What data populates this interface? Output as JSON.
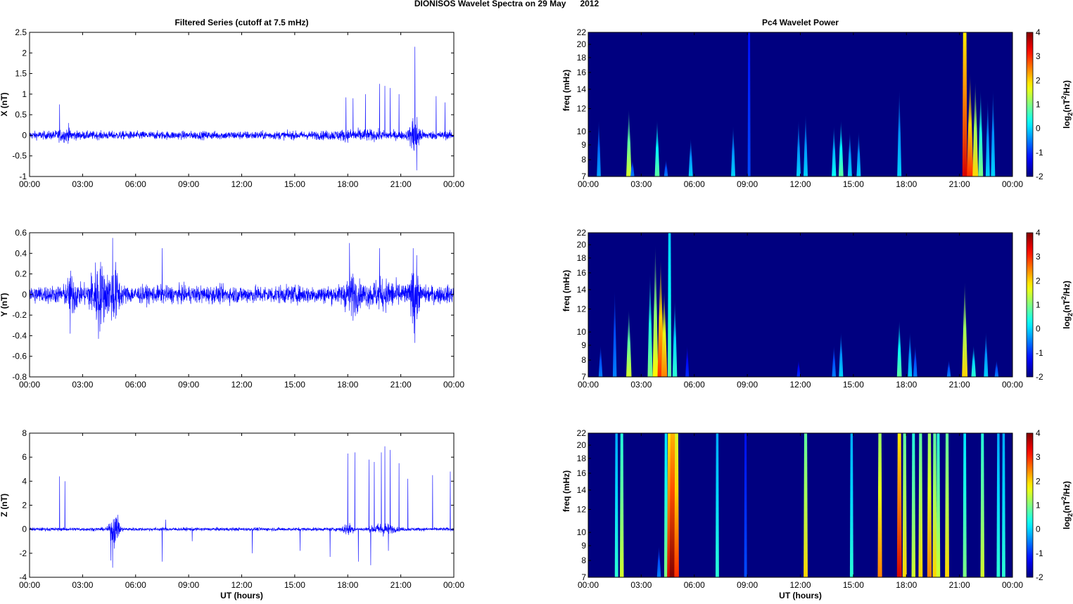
{
  "figure_title": "DIONISOS Wavelet Spectra on 29 May      2012",
  "chart_data": [
    {
      "type": "line",
      "title": "Filtered Series (cutoff at 7.5 mHz)",
      "ylabel": "X (nT)",
      "xlabel": "",
      "xlim": [
        0,
        24
      ],
      "ylim": [
        -1,
        2.5
      ],
      "xticks": [
        "00:00",
        "03:00",
        "06:00",
        "09:00",
        "12:00",
        "15:00",
        "18:00",
        "21:00",
        "00:00"
      ],
      "yticks": [
        -1,
        -0.5,
        0,
        0.5,
        1,
        1.5,
        2,
        2.5
      ],
      "color": "#0000ff",
      "noise_amplitude": 0.07,
      "bursts": [
        [
          21.8,
          0.25,
          0.35
        ],
        [
          2.0,
          0.5,
          0.05
        ],
        [
          18.5,
          1.5,
          0.04
        ]
      ],
      "spikes": [
        [
          1.7,
          0.75
        ],
        [
          2.2,
          0.3
        ],
        [
          17.9,
          0.92
        ],
        [
          18.3,
          0.9
        ],
        [
          19.0,
          1.0
        ],
        [
          19.8,
          1.25
        ],
        [
          20.1,
          1.2
        ],
        [
          20.4,
          1.15
        ],
        [
          20.9,
          1.0
        ],
        [
          21.8,
          2.15
        ],
        [
          21.9,
          -0.85
        ],
        [
          23.0,
          0.95
        ],
        [
          23.5,
          0.8
        ]
      ]
    },
    {
      "type": "line",
      "title": "",
      "ylabel": "Y (nT)",
      "xlabel": "",
      "xlim": [
        0,
        24
      ],
      "ylim": [
        -0.8,
        0.6
      ],
      "xticks": [
        "00:00",
        "03:00",
        "06:00",
        "09:00",
        "12:00",
        "15:00",
        "18:00",
        "21:00",
        "00:00"
      ],
      "yticks": [
        -0.8,
        -0.6,
        -0.4,
        -0.2,
        0,
        0.2,
        0.4,
        0.6
      ],
      "color": "#0000ff",
      "noise_amplitude": 0.06,
      "bursts": [
        [
          3.9,
          0.5,
          0.18
        ],
        [
          2.4,
          0.3,
          0.1
        ],
        [
          4.8,
          0.3,
          0.15
        ],
        [
          18.2,
          0.4,
          0.1
        ],
        [
          21.8,
          0.2,
          0.2
        ],
        [
          20.0,
          1.0,
          0.05
        ]
      ],
      "spikes": [
        [
          2.3,
          -0.38
        ],
        [
          4.7,
          0.55
        ],
        [
          3.9,
          -0.43
        ],
        [
          7.5,
          0.45
        ],
        [
          18.1,
          0.5
        ],
        [
          19.8,
          0.45
        ],
        [
          21.7,
          0.45
        ],
        [
          21.8,
          -0.47
        ]
      ]
    },
    {
      "type": "line",
      "title": "",
      "ylabel": "Z (nT)",
      "xlabel": "UT (hours)",
      "xlim": [
        0,
        24
      ],
      "ylim": [
        -4,
        8
      ],
      "xticks": [
        "00:00",
        "03:00",
        "06:00",
        "09:00",
        "12:00",
        "15:00",
        "18:00",
        "21:00",
        "00:00"
      ],
      "yticks": [
        -4,
        -2,
        0,
        2,
        4,
        6,
        8
      ],
      "color": "#0000ff",
      "noise_amplitude": 0.1,
      "bursts": [
        [
          4.8,
          0.25,
          0.9
        ],
        [
          18.0,
          0.3,
          0.3
        ],
        [
          20.0,
          0.6,
          0.3
        ]
      ],
      "spikes": [
        [
          1.7,
          4.4
        ],
        [
          2.0,
          4.0
        ],
        [
          4.7,
          -3.2
        ],
        [
          4.6,
          -2.6
        ],
        [
          5.0,
          1.2
        ],
        [
          7.5,
          -2.7
        ],
        [
          7.7,
          0.8
        ],
        [
          9.2,
          -1.0
        ],
        [
          12.6,
          -2.0
        ],
        [
          15.3,
          -1.8
        ],
        [
          17.0,
          -2.3
        ],
        [
          18.0,
          6.3
        ],
        [
          18.4,
          6.4
        ],
        [
          18.6,
          -2.7
        ],
        [
          19.2,
          5.8
        ],
        [
          19.3,
          -3.0
        ],
        [
          19.5,
          5.6
        ],
        [
          19.9,
          6.4
        ],
        [
          20.1,
          6.9
        ],
        [
          20.3,
          -1.8
        ],
        [
          20.4,
          6.6
        ],
        [
          20.9,
          5.5
        ],
        [
          21.4,
          4.2
        ],
        [
          22.8,
          4.5
        ],
        [
          23.8,
          4.8
        ]
      ]
    },
    {
      "type": "heatmap",
      "title": "Pc4 Wavelet Power",
      "ylabel": "freq (mHz)",
      "xlabel": "",
      "xlim": [
        0,
        24
      ],
      "ylim": [
        7,
        22
      ],
      "yscale": "log",
      "xticks": [
        "00:00",
        "03:00",
        "06:00",
        "09:00",
        "12:00",
        "15:00",
        "18:00",
        "21:00",
        "00:00"
      ],
      "yticks": [
        7,
        8,
        9,
        10,
        12,
        14,
        16,
        18,
        20,
        22
      ],
      "clim": [
        -2,
        4
      ],
      "cticks": [
        -2,
        -1,
        0,
        1,
        2,
        3,
        4
      ],
      "colorbar_label": [
        "log",
        "2",
        "(nT",
        "2",
        "/Hz)"
      ],
      "background_power": -2,
      "bursts_time_fmax_power": [
        [
          0.6,
          11,
          -0.3
        ],
        [
          2.3,
          12,
          1.5
        ],
        [
          2.5,
          8,
          -0.5
        ],
        [
          3.9,
          11,
          0.8
        ],
        [
          4.4,
          8,
          -0.5
        ],
        [
          5.8,
          9.5,
          0
        ],
        [
          8.2,
          10.5,
          0
        ],
        [
          9.1,
          22,
          -0.8
        ],
        [
          11.9,
          11,
          0
        ],
        [
          12.3,
          11.5,
          0
        ],
        [
          13.9,
          10.5,
          0.3
        ],
        [
          14.3,
          11,
          0.8
        ],
        [
          14.8,
          10,
          0
        ],
        [
          15.3,
          10,
          0
        ],
        [
          17.6,
          14,
          0
        ],
        [
          21.3,
          22,
          3.5
        ],
        [
          21.6,
          16,
          3
        ],
        [
          21.9,
          15,
          2
        ],
        [
          22.2,
          14,
          1
        ],
        [
          22.6,
          13,
          0
        ],
        [
          22.9,
          14,
          0
        ]
      ]
    },
    {
      "type": "heatmap",
      "title": "",
      "ylabel": "freq (mHz)",
      "xlabel": "",
      "xlim": [
        0,
        24
      ],
      "ylim": [
        7,
        22
      ],
      "yscale": "log",
      "xticks": [
        "00:00",
        "03:00",
        "06:00",
        "09:00",
        "12:00",
        "15:00",
        "18:00",
        "21:00",
        "00:00"
      ],
      "yticks": [
        7,
        8,
        9,
        10,
        12,
        14,
        16,
        18,
        20,
        22
      ],
      "clim": [
        -2,
        4
      ],
      "cticks": [
        -2,
        -1,
        0,
        1,
        2,
        3,
        4
      ],
      "colorbar_label": [
        "log",
        "2",
        "(nT",
        "2",
        "/Hz)"
      ],
      "background_power": -2,
      "bursts_time_fmax_power": [
        [
          0.7,
          9,
          -0.5
        ],
        [
          1.5,
          14,
          -0.5
        ],
        [
          2.3,
          12,
          1.5
        ],
        [
          3.5,
          16,
          1
        ],
        [
          3.8,
          20,
          1.8
        ],
        [
          4.1,
          18,
          3
        ],
        [
          4.3,
          14,
          2.5
        ],
        [
          4.6,
          22,
          0.8
        ],
        [
          4.9,
          13,
          0.5
        ],
        [
          5.6,
          9,
          -1
        ],
        [
          11.9,
          8,
          -1
        ],
        [
          13.9,
          9,
          -0.5
        ],
        [
          14.3,
          10,
          0
        ],
        [
          17.6,
          11,
          0.8
        ],
        [
          18.2,
          10,
          0
        ],
        [
          18.5,
          9,
          -0.5
        ],
        [
          20.4,
          8,
          -0.5
        ],
        [
          21.3,
          15,
          2
        ],
        [
          21.8,
          9,
          0.5
        ],
        [
          22.5,
          10,
          0
        ],
        [
          23.1,
          8,
          -0.5
        ]
      ]
    },
    {
      "type": "heatmap",
      "title": "",
      "ylabel": "freq (mHz)",
      "xlabel": "UT (hours)",
      "xlim": [
        0,
        24
      ],
      "ylim": [
        7,
        22
      ],
      "yscale": "log",
      "xticks": [
        "00:00",
        "03:00",
        "06:00",
        "09:00",
        "12:00",
        "15:00",
        "18:00",
        "21:00",
        "00:00"
      ],
      "yticks": [
        7,
        8,
        9,
        10,
        12,
        14,
        16,
        18,
        20,
        22
      ],
      "clim": [
        -2,
        4
      ],
      "cticks": [
        -2,
        -1,
        0,
        1,
        2,
        3,
        4
      ],
      "colorbar_label": [
        "log",
        "2",
        "(nT",
        "2",
        "/Hz)"
      ],
      "background_power": -2,
      "bursts_time_fmax_power": [
        [
          1.6,
          22,
          0.5
        ],
        [
          1.9,
          22,
          1.5
        ],
        [
          4.0,
          9,
          -0.5
        ],
        [
          4.4,
          22,
          1
        ],
        [
          4.6,
          22,
          3.5
        ],
        [
          4.75,
          22,
          4
        ],
        [
          4.9,
          22,
          4
        ],
        [
          5.0,
          22,
          3
        ],
        [
          7.3,
          22,
          0.5
        ],
        [
          8.9,
          22,
          -0.8
        ],
        [
          12.3,
          22,
          2
        ],
        [
          14.9,
          22,
          0.5
        ],
        [
          16.5,
          22,
          2.5
        ],
        [
          17.6,
          22,
          3.5
        ],
        [
          17.9,
          22,
          2
        ],
        [
          18.4,
          22,
          1.5
        ],
        [
          18.8,
          22,
          2
        ],
        [
          19.3,
          22,
          2.5
        ],
        [
          19.6,
          22,
          2
        ],
        [
          19.8,
          22,
          1.5
        ],
        [
          20.3,
          22,
          2
        ],
        [
          21.3,
          22,
          1
        ],
        [
          22.3,
          22,
          1.5
        ],
        [
          23.2,
          22,
          0.5
        ],
        [
          23.5,
          22,
          0.5
        ]
      ]
    }
  ]
}
